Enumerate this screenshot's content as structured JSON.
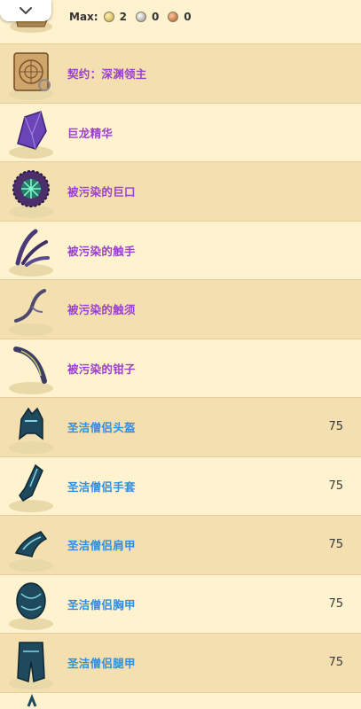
{
  "header": {
    "max_label": "Max:",
    "max_gold": "2",
    "max_silver": "0",
    "max_copper": "0"
  },
  "items": [
    {
      "name": "契约：深渊领主",
      "color": "purple",
      "icon": "map-scroll-icon",
      "level": ""
    },
    {
      "name": "巨龙精华",
      "color": "purple",
      "icon": "crystal-icon",
      "level": ""
    },
    {
      "name": "被污染的巨口",
      "color": "purple",
      "icon": "spiked-maw-icon",
      "level": ""
    },
    {
      "name": "被污染的触手",
      "color": "purple",
      "icon": "tentacle-icon",
      "level": ""
    },
    {
      "name": "被污染的触须",
      "color": "purple",
      "icon": "feeler-icon",
      "level": ""
    },
    {
      "name": "被污染的钳子",
      "color": "purple",
      "icon": "pincer-icon",
      "level": ""
    },
    {
      "name": "圣洁僧侣头盔",
      "color": "blue",
      "icon": "helmet-icon",
      "level": "75"
    },
    {
      "name": "圣洁僧侣手套",
      "color": "blue",
      "icon": "gloves-icon",
      "level": "75"
    },
    {
      "name": "圣洁僧侣肩甲",
      "color": "blue",
      "icon": "shoulders-icon",
      "level": "75"
    },
    {
      "name": "圣洁僧侣胸甲",
      "color": "blue",
      "icon": "chest-icon",
      "level": "75"
    },
    {
      "name": "圣洁僧侣腿甲",
      "color": "blue",
      "icon": "legs-icon",
      "level": "75"
    }
  ],
  "colors": {
    "purple": "#9b3fd1",
    "blue": "#2f8ee0",
    "row_odd": "#fff2cf",
    "row_even": "#f3dfb0"
  }
}
